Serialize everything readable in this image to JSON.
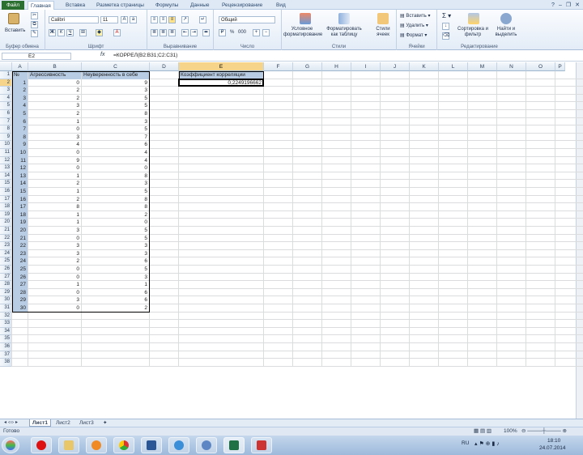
{
  "ribbon_tabs": [
    "Файл",
    "Главная",
    "Вставка",
    "Разметка страницы",
    "Формулы",
    "Данные",
    "Рецензирование",
    "Вид"
  ],
  "ribbon": {
    "paste_label": "Вставить",
    "clipboard_label": "Буфер обмена",
    "font_name": "Calibri",
    "font_size": "11",
    "font_label": "Шрифт",
    "align_label": "Выравнивание",
    "number_format": "Общий",
    "number_label": "Число",
    "cond_format": "Условное форматирование",
    "format_table": "Форматировать как таблицу",
    "cell_styles": "Стили ячеек",
    "styles_label": "Стили",
    "insert_label": "Вставить",
    "delete_label": "Удалить",
    "format_label": "Формат",
    "cells_label": "Ячейки",
    "sort_filter": "Сортировка и фильтр",
    "find_select": "Найти и выделить",
    "editing_label": "Редактирование",
    "percent": "%",
    "thousands": "000"
  },
  "formula_bar": {
    "name_box": "E2",
    "fx": "fx",
    "formula": "=КОРРЕЛ(B2:B31;C2:C31)"
  },
  "columns": [
    "A",
    "B",
    "C",
    "D",
    "E",
    "F",
    "G",
    "H",
    "I",
    "J",
    "K",
    "L",
    "M",
    "N",
    "O",
    "P"
  ],
  "row_numbers": [
    "1",
    "2",
    "3",
    "4",
    "5",
    "6",
    "7",
    "8",
    "9",
    "10",
    "11",
    "12",
    "13",
    "14",
    "15",
    "16",
    "17",
    "18",
    "19",
    "20",
    "21",
    "22",
    "23",
    "24",
    "25",
    "26",
    "27",
    "28",
    "29",
    "30",
    "31",
    "32",
    "33",
    "34",
    "35",
    "36",
    "37",
    "38"
  ],
  "table": {
    "headers": [
      "№",
      "Агрессивность",
      "Неуверенность в себе"
    ],
    "nums": [
      "1",
      "2",
      "3",
      "4",
      "5",
      "6",
      "7",
      "8",
      "9",
      "10",
      "11",
      "12",
      "13",
      "14",
      "15",
      "16",
      "17",
      "18",
      "19",
      "20",
      "21",
      "22",
      "23",
      "24",
      "25",
      "26",
      "27",
      "28",
      "29",
      "30"
    ],
    "b": [
      "0",
      "2",
      "2",
      "3",
      "2",
      "1",
      "0",
      "3",
      "4",
      "0",
      "9",
      "0",
      "1",
      "2",
      "1",
      "2",
      "8",
      "1",
      "1",
      "3",
      "0",
      "3",
      "3",
      "2",
      "0",
      "0",
      "1",
      "0",
      "3",
      "0"
    ],
    "c": [
      "9",
      "3",
      "5",
      "5",
      "8",
      "3",
      "5",
      "7",
      "6",
      "4",
      "4",
      "0",
      "8",
      "3",
      "5",
      "8",
      "8",
      "2",
      "0",
      "5",
      "5",
      "3",
      "3",
      "6",
      "5",
      "3",
      "1",
      "6",
      "6",
      "2"
    ]
  },
  "result": {
    "label": "Коэффициент корреляции",
    "value": "0,2249196662"
  },
  "sheets": [
    "Лист1",
    "Лист2",
    "Лист3"
  ],
  "status": {
    "ready": "Готово",
    "zoom": "100%"
  },
  "tray": {
    "lang": "RU",
    "time": "18:10",
    "date": "24.07.2014"
  },
  "colors": {
    "header_fill": "#b8cce4",
    "file_tab": "#2a6f2f",
    "selected_header": "#f6d48a"
  }
}
